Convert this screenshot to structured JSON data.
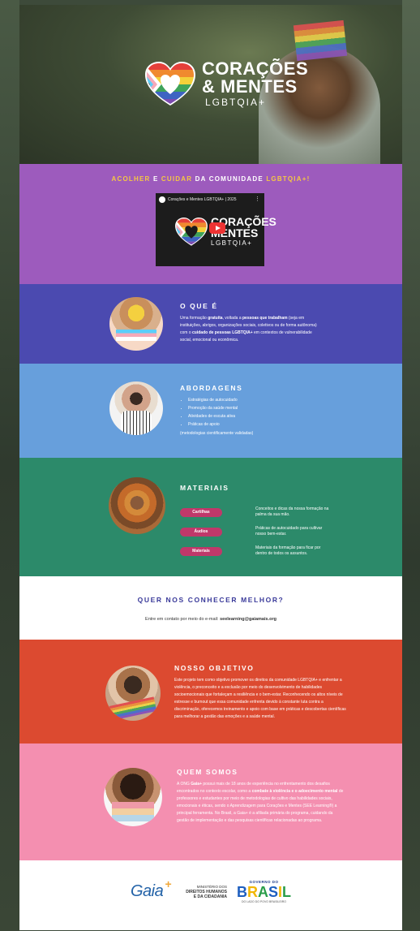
{
  "hero": {
    "logo_line1": "CORAÇÕES",
    "logo_line2": "& MENTES",
    "logo_line3": "LGBTQIA+"
  },
  "intro": {
    "tagline_part1": "ACOLHER",
    "tagline_and": "E",
    "tagline_part2": "CUIDAR",
    "tagline_part3": "DA COMUNIDADE",
    "tagline_part4": "LGBTQIA+!",
    "video_title": "Corações e Mentes LGBTQIA+ | 2025",
    "video_logo_line1": "CORAÇÕES",
    "video_logo_line2": "MENTES",
    "video_logo_line3": "LGBTQIA+"
  },
  "o_que_e": {
    "title": "O QUE É",
    "text_1": "Uma formação ",
    "text_bold_1": "gratuita",
    "text_2": ", voltada a ",
    "text_bold_2": "pessoas que trabalham",
    "text_3": " (seja em instituições, abrigos, organizações sociais, coletivos ou de forma autônoma) com o ",
    "text_bold_3": "cuidado de pessoas LGBTQIA+",
    "text_4": " em contextos de vulnerabilidade social, emocional ou econômica."
  },
  "abordagens": {
    "title": "ABORDAGENS",
    "items": [
      "Estratégias de autocuidado",
      "Promoção da saúde mental",
      "Atividades de escuta ativa",
      "Práticas de apoio"
    ],
    "note": "(metodologias cientificamente validadas)"
  },
  "materiais": {
    "title": "MATERIAIS",
    "items": [
      {
        "label": "Cartilhas",
        "desc": "Conceitos e dicas da nossa formação na palma da sua mão."
      },
      {
        "label": "Áudios",
        "desc": "Práticas de autocuidado para cultivar nosso bem-estar."
      },
      {
        "label": "Materiais",
        "desc": "Materiais da formação para ficar por dentro de todos os assuntos."
      }
    ]
  },
  "contato": {
    "title": "QUER NOS CONHECER MELHOR?",
    "text": "Entre em contato por meio do e-mail:",
    "email": "seelearning@gaiamais.org"
  },
  "objetivo": {
    "title": "NOSSO OBJETIVO",
    "text": "Este projeto tem como objetivo promover os direitos da comunidade LGBTQIA+ e enfrentar a violência, o preconceito e a exclusão por meio do desenvolvimento de habilidades socioemocionais que fortaleçam a resiliência e o bem-estar. Reconhecendo os altos níveis de estresse e burnout que essa comunidade enfrenta devido à constante luta contra a discriminação, oferecemos treinamento e apoio com base em práticas e descobertas científicas para melhorar a gestão das emoções e a saúde mental."
  },
  "quem_somos": {
    "title": "QUEM SOMOS",
    "text_1": "A ONG ",
    "text_bold_1": "Gaia+",
    "text_2": " possui mais de 18 anos de experiência no enfrentamento dos desafios encontrados no contexto escolar, como a ",
    "text_bold_2": "combate à violência e o adoecimento mental",
    "text_3": " de professores e estudantes por meio de metodologias de cultivo das habilidades sociais, emocionais e éticas, sendo o Aprendizagem para Corações e Mentes (SEE Learning®) a principal ferramenta. No Brasil, a Gaia+ é a afiliada primária do programa, cuidando da gestão de implementação e das pesquisas científicas relacionadas ao programa."
  },
  "footer": {
    "gaia": "Gaia",
    "gaia_plus": "+",
    "ministry_line1": "MINISTÉRIO DOS",
    "ministry_line2": "DIREITOS HUMANOS",
    "ministry_line3": "E DA CIDADANIA",
    "gov_line1": "GOVERNO DO",
    "brasil": "BRASIL",
    "gov_line3": "DO LADO DO POVO BRASILEIRO"
  }
}
